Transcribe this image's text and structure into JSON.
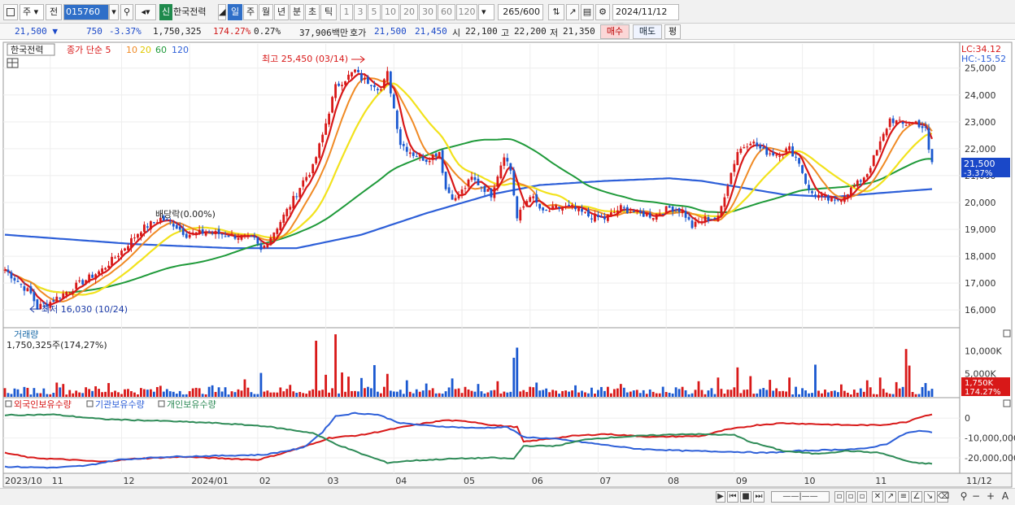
{
  "toolbar": {
    "period_select": "주",
    "prev_label": "전",
    "code": "015760",
    "stock_name": "한국전력",
    "badge": "신",
    "periods": [
      "일",
      "주",
      "월",
      "년",
      "분",
      "초",
      "틱"
    ],
    "active_period": "일",
    "intervals": [
      "1",
      "3",
      "5",
      "10",
      "20",
      "30",
      "60",
      "120"
    ],
    "count": "265",
    "count_total": "/600",
    "date": "2024/11/12"
  },
  "quote": {
    "price": "21,500",
    "change": "750",
    "change_pct": "-3.37%",
    "volume": "1,750,325",
    "vol_ratio": "174.27%",
    "turnover_ratio": "0.27%",
    "amount": "37,906백만",
    "ask_label": "호가",
    "ask1": "21,500",
    "ask2": "21,450",
    "open_label": "시",
    "open": "22,100",
    "high_label": "고",
    "high": "22,200",
    "low_label": "저",
    "low": "21,350",
    "buy_label": "매수",
    "sell_label": "매도",
    "eval_label": "평"
  },
  "colors": {
    "up": "#d81818",
    "down": "#1a58d0",
    "ma5": "#d81818",
    "ma10": "#f08a24",
    "ma20": "#f2e21c",
    "ma60": "#1f9a3a",
    "ma120": "#2d5fd8",
    "foreign": "#d81818",
    "inst": "#2d5fd8",
    "indiv": "#2e8b57"
  },
  "chart_data": [
    {
      "type": "candlestick",
      "panel": "price",
      "stock_label": "한국전력",
      "legend": {
        "title": "종가 단순",
        "periods": [
          "5",
          "10",
          "20",
          "60",
          "120"
        ]
      },
      "lc_label": "LC:34.12",
      "hc_label": "HC:-15.52",
      "ylim": [
        15400,
        25900
      ],
      "y_ticks": [
        16000,
        17000,
        18000,
        19000,
        20000,
        21000,
        22000,
        23000,
        24000,
        25000
      ],
      "y_tick_labels": [
        "16,000",
        "17,000",
        "18,000",
        "19,000",
        "20,000",
        "21,000",
        "22,000",
        "23,000",
        "24,000",
        "25,000"
      ],
      "annotations": {
        "high": "최고 25,450 (03/14)",
        "low": "최저 16,030 (10/24)",
        "dividend": "배당락(0.00%)"
      },
      "last_price_label": "21,500",
      "last_change_label": "-3.37%",
      "x_labels": [
        "2023/10",
        "11",
        "12",
        "2024/01",
        "02",
        "03",
        "04",
        "05",
        "06",
        "07",
        "08",
        "09",
        "10",
        "11",
        "11/12"
      ],
      "close_keypoints": [
        [
          0,
          17500
        ],
        [
          8,
          16600
        ],
        [
          10,
          16100
        ],
        [
          14,
          16300
        ],
        [
          22,
          16900
        ],
        [
          30,
          17500
        ],
        [
          36,
          18200
        ],
        [
          42,
          19000
        ],
        [
          48,
          19400
        ],
        [
          52,
          19200
        ],
        [
          56,
          18800
        ],
        [
          62,
          18900
        ],
        [
          68,
          18800
        ],
        [
          74,
          18700
        ],
        [
          77,
          18600
        ],
        [
          79,
          18200
        ],
        [
          84,
          19100
        ],
        [
          88,
          19900
        ],
        [
          92,
          20800
        ],
        [
          95,
          21300
        ],
        [
          98,
          22500
        ],
        [
          102,
          24300
        ],
        [
          104,
          24500
        ],
        [
          108,
          24900
        ],
        [
          110,
          24600
        ],
        [
          114,
          24400
        ],
        [
          116,
          24200
        ],
        [
          118,
          24800
        ],
        [
          120,
          23500
        ],
        [
          122,
          22200
        ],
        [
          126,
          21800
        ],
        [
          130,
          21600
        ],
        [
          134,
          21900
        ],
        [
          136,
          20500
        ],
        [
          139,
          20100
        ],
        [
          144,
          20900
        ],
        [
          150,
          20300
        ],
        [
          154,
          21800
        ],
        [
          156,
          21200
        ],
        [
          158,
          19400
        ],
        [
          162,
          20300
        ],
        [
          166,
          19600
        ],
        [
          170,
          19800
        ],
        [
          175,
          19800
        ],
        [
          180,
          19500
        ],
        [
          185,
          19400
        ],
        [
          190,
          19800
        ],
        [
          195,
          19600
        ],
        [
          200,
          19500
        ],
        [
          205,
          19800
        ],
        [
          209,
          19700
        ],
        [
          212,
          19100
        ],
        [
          216,
          19400
        ],
        [
          220,
          19400
        ],
        [
          222,
          20300
        ],
        [
          226,
          21900
        ],
        [
          230,
          22300
        ],
        [
          234,
          21900
        ],
        [
          238,
          21800
        ],
        [
          242,
          22000
        ],
        [
          245,
          21500
        ],
        [
          248,
          20400
        ],
        [
          252,
          20200
        ],
        [
          256,
          20000
        ],
        [
          260,
          20400
        ],
        [
          263,
          20700
        ],
        [
          266,
          21100
        ],
        [
          270,
          22200
        ],
        [
          273,
          23100
        ],
        [
          277,
          22900
        ],
        [
          281,
          23000
        ],
        [
          284,
          22700
        ],
        [
          285,
          21900
        ],
        [
          286,
          21500
        ]
      ],
      "ma120_keypoints": [
        [
          0,
          18800
        ],
        [
          40,
          18450
        ],
        [
          70,
          18300
        ],
        [
          90,
          18300
        ],
        [
          110,
          18800
        ],
        [
          130,
          19600
        ],
        [
          150,
          20300
        ],
        [
          165,
          20650
        ],
        [
          185,
          20800
        ],
        [
          205,
          20900
        ],
        [
          215,
          20800
        ],
        [
          225,
          20600
        ],
        [
          240,
          20300
        ],
        [
          255,
          20200
        ],
        [
          270,
          20350
        ],
        [
          286,
          20500
        ]
      ]
    },
    {
      "type": "bar",
      "panel": "volume",
      "title": "거래량",
      "value_label": "1,750,325주(174,27%)",
      "ylim": [
        0,
        14500
      ],
      "y_ticks": [
        5000,
        10000
      ],
      "y_tick_labels": [
        "5,000K",
        "10,000K"
      ],
      "last_value_label": "1,750K",
      "last_pct_label": "174.27%",
      "spikes": [
        [
          16,
          3100
        ],
        [
          18,
          2800
        ],
        [
          28,
          2300
        ],
        [
          32,
          3000
        ],
        [
          48,
          2400
        ],
        [
          64,
          2500
        ],
        [
          74,
          3800
        ],
        [
          79,
          5200
        ],
        [
          88,
          2600
        ],
        [
          96,
          12200
        ],
        [
          99,
          4800
        ],
        [
          102,
          13600
        ],
        [
          104,
          5300
        ],
        [
          106,
          4400
        ],
        [
          110,
          4100
        ],
        [
          114,
          6900
        ],
        [
          118,
          5000
        ],
        [
          124,
          3600
        ],
        [
          130,
          2900
        ],
        [
          138,
          4000
        ],
        [
          146,
          2800
        ],
        [
          152,
          3400
        ],
        [
          157,
          8500
        ],
        [
          158,
          10700
        ],
        [
          164,
          3100
        ],
        [
          176,
          2500
        ],
        [
          190,
          2800
        ],
        [
          203,
          2200
        ],
        [
          214,
          3400
        ],
        [
          220,
          4200
        ],
        [
          226,
          6400
        ],
        [
          230,
          4500
        ],
        [
          236,
          3700
        ],
        [
          242,
          4200
        ],
        [
          250,
          7000
        ],
        [
          258,
          2700
        ],
        [
          266,
          3600
        ],
        [
          270,
          4200
        ],
        [
          275,
          3200
        ],
        [
          278,
          10400
        ],
        [
          279,
          6800
        ],
        [
          284,
          3000
        ],
        [
          286,
          1750
        ]
      ]
    },
    {
      "type": "line",
      "panel": "holdings",
      "legend": [
        "외국인보유수량",
        "기관보유수량",
        "개인보유수량"
      ],
      "ylim": [
        -27000000,
        5000000
      ],
      "y_ticks": [
        0,
        -10000000,
        -20000000
      ],
      "y_tick_labels": [
        "0",
        "-10,000,000",
        "-20,000,000"
      ],
      "series": [
        {
          "name": "외국인보유수량",
          "key": "foreign",
          "points": [
            [
              0,
              -17500000
            ],
            [
              8,
              -20000000
            ],
            [
              20,
              -21000000
            ],
            [
              30,
              -22000000
            ],
            [
              40,
              -20500000
            ],
            [
              55,
              -19500000
            ],
            [
              70,
              -20500000
            ],
            [
              78,
              -21000000
            ],
            [
              85,
              -18000000
            ],
            [
              95,
              -13000000
            ],
            [
              100,
              -10000000
            ],
            [
              110,
              -8500000
            ],
            [
              118,
              -6000000
            ],
            [
              126,
              -3500000
            ],
            [
              136,
              -1000000
            ],
            [
              145,
              -2000000
            ],
            [
              150,
              -3500000
            ],
            [
              158,
              -4500000
            ],
            [
              160,
              -12000000
            ],
            [
              165,
              -11000000
            ],
            [
              175,
              -9000000
            ],
            [
              185,
              -8000000
            ],
            [
              200,
              -9500000
            ],
            [
              215,
              -9000000
            ],
            [
              222,
              -6000000
            ],
            [
              232,
              -3500000
            ],
            [
              240,
              -2500000
            ],
            [
              250,
              -3000000
            ],
            [
              260,
              -3500000
            ],
            [
              270,
              -3500000
            ],
            [
              278,
              -2000000
            ],
            [
              282,
              500000
            ],
            [
              286,
              2000000
            ]
          ]
        },
        {
          "name": "기관보유수량",
          "key": "inst",
          "points": [
            [
              0,
              -24500000
            ],
            [
              15,
              -25000000
            ],
            [
              25,
              -24000000
            ],
            [
              35,
              -21000000
            ],
            [
              50,
              -19500000
            ],
            [
              65,
              -19000000
            ],
            [
              80,
              -18500000
            ],
            [
              92,
              -15000000
            ],
            [
              98,
              -7000000
            ],
            [
              102,
              1000000
            ],
            [
              108,
              2500000
            ],
            [
              115,
              1800000
            ],
            [
              122,
              -2500000
            ],
            [
              132,
              -4000000
            ],
            [
              145,
              -5000000
            ],
            [
              155,
              -4500000
            ],
            [
              160,
              -9500000
            ],
            [
              170,
              -10500000
            ],
            [
              180,
              -12500000
            ],
            [
              195,
              -15500000
            ],
            [
              210,
              -16500000
            ],
            [
              225,
              -17000000
            ],
            [
              235,
              -17500000
            ],
            [
              245,
              -16500000
            ],
            [
              255,
              -16000000
            ],
            [
              265,
              -15500000
            ],
            [
              272,
              -13000000
            ],
            [
              278,
              -7500000
            ],
            [
              282,
              -6500000
            ],
            [
              286,
              -7000000
            ]
          ]
        },
        {
          "name": "개인보유수량",
          "key": "indiv",
          "points": [
            [
              0,
              1500000
            ],
            [
              15,
              1800000
            ],
            [
              30,
              -500000
            ],
            [
              50,
              -1500000
            ],
            [
              65,
              -2500000
            ],
            [
              80,
              -4000000
            ],
            [
              95,
              -7500000
            ],
            [
              102,
              -13000000
            ],
            [
              110,
              -18000000
            ],
            [
              118,
              -22500000
            ],
            [
              125,
              -21500000
            ],
            [
              138,
              -20500000
            ],
            [
              150,
              -20000000
            ],
            [
              157,
              -20500000
            ],
            [
              160,
              -14000000
            ],
            [
              170,
              -14000000
            ],
            [
              180,
              -10500000
            ],
            [
              195,
              -9000000
            ],
            [
              210,
              -8000000
            ],
            [
              225,
              -8500000
            ],
            [
              230,
              -12000000
            ],
            [
              240,
              -16500000
            ],
            [
              250,
              -18000000
            ],
            [
              260,
              -16500000
            ],
            [
              270,
              -17500000
            ],
            [
              276,
              -20500000
            ],
            [
              280,
              -22500000
            ],
            [
              286,
              -23000000
            ]
          ]
        }
      ]
    }
  ],
  "bottom": {
    "nav_buttons": [
      "▶",
      "⏮",
      "■",
      "⏭"
    ],
    "zoom_minus": "−",
    "zoom_plus": "+",
    "magnify": "⚲",
    "text_tool": "A"
  }
}
